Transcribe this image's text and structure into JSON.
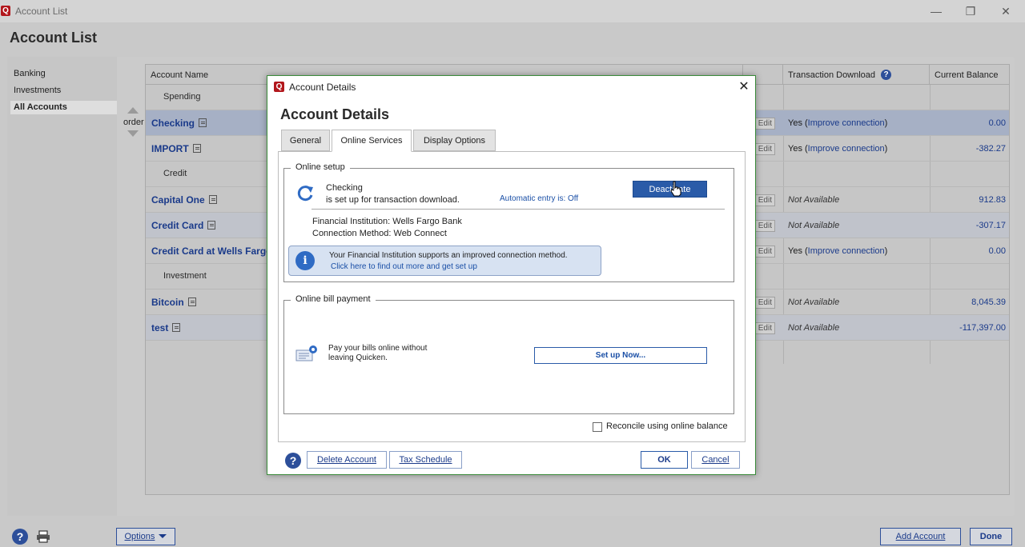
{
  "window": {
    "title": "Account List",
    "app_logo": "Q",
    "minimize": "—",
    "restore": "❐",
    "close": "✕"
  },
  "page": {
    "title": "Account List"
  },
  "sidebar": {
    "items": [
      {
        "label": "Banking"
      },
      {
        "label": "Investments"
      },
      {
        "label": "All Accounts"
      }
    ]
  },
  "order": {
    "label": "order"
  },
  "table": {
    "columns": {
      "account_name": "Account Name",
      "transaction_download": "Transaction Download",
      "current_balance": "Current Balance"
    },
    "edit_label": "Edit",
    "groups": {
      "spending": "Spending",
      "credit": "Credit",
      "investment": "Investment"
    },
    "rows": [
      {
        "name": "Checking",
        "download": "Yes (",
        "link": "Improve connection",
        "close": ")",
        "balance": "0.00"
      },
      {
        "name": "IMPORT",
        "download": "Yes (",
        "link": "Improve connection",
        "close": ")",
        "balance": "-382.27"
      },
      {
        "name": "Capital One",
        "download": "Not Available",
        "balance": "912.83"
      },
      {
        "name": "Credit Card",
        "download": "Not Available",
        "balance": "-307.17"
      },
      {
        "name": "Credit Card at Wells Fargo B",
        "download": "Yes (",
        "link": "Improve connection",
        "close": ")",
        "balance": "0.00"
      },
      {
        "name": "Bitcoin",
        "download": "Not Available",
        "balance": "8,045.39"
      },
      {
        "name": "test",
        "download": "Not Available",
        "balance": "-117,397.00"
      }
    ]
  },
  "bottom": {
    "options": "Options",
    "add_account": "Add Account",
    "done": "Done"
  },
  "dialog": {
    "window_title": "Account Details",
    "heading": "Account Details",
    "tabs": [
      "General",
      "Online Services",
      "Display Options"
    ],
    "online_setup": {
      "legend": "Online setup",
      "account": "Checking",
      "status": "is set up for transaction download.",
      "auto_entry": "Automatic entry is: Off",
      "deactivate": "Deactivate",
      "fi_label": "Financial Institution: Wells Fargo Bank",
      "method_label": "Connection Method: Web Connect",
      "banner_text": "Your Financial Institution supports an improved connection method.",
      "banner_link": "Click here to find out more and get set up"
    },
    "bill_payment": {
      "legend": "Online bill payment",
      "text_line1": "Pay your bills online without",
      "text_line2": "leaving Quicken.",
      "setup_button": "Set up Now..."
    },
    "reconcile_label": "Reconcile using online balance",
    "buttons": {
      "delete": "Delete Account",
      "tax": "Tax Schedule",
      "ok": "OK",
      "cancel": "Cancel"
    }
  },
  "colors": {
    "accent": "#2d4f9a",
    "selected_row": "#a6b0c5",
    "link": "#1a3a8a",
    "brand": "#b2171c",
    "dialog_border": "#3a8b3a"
  }
}
